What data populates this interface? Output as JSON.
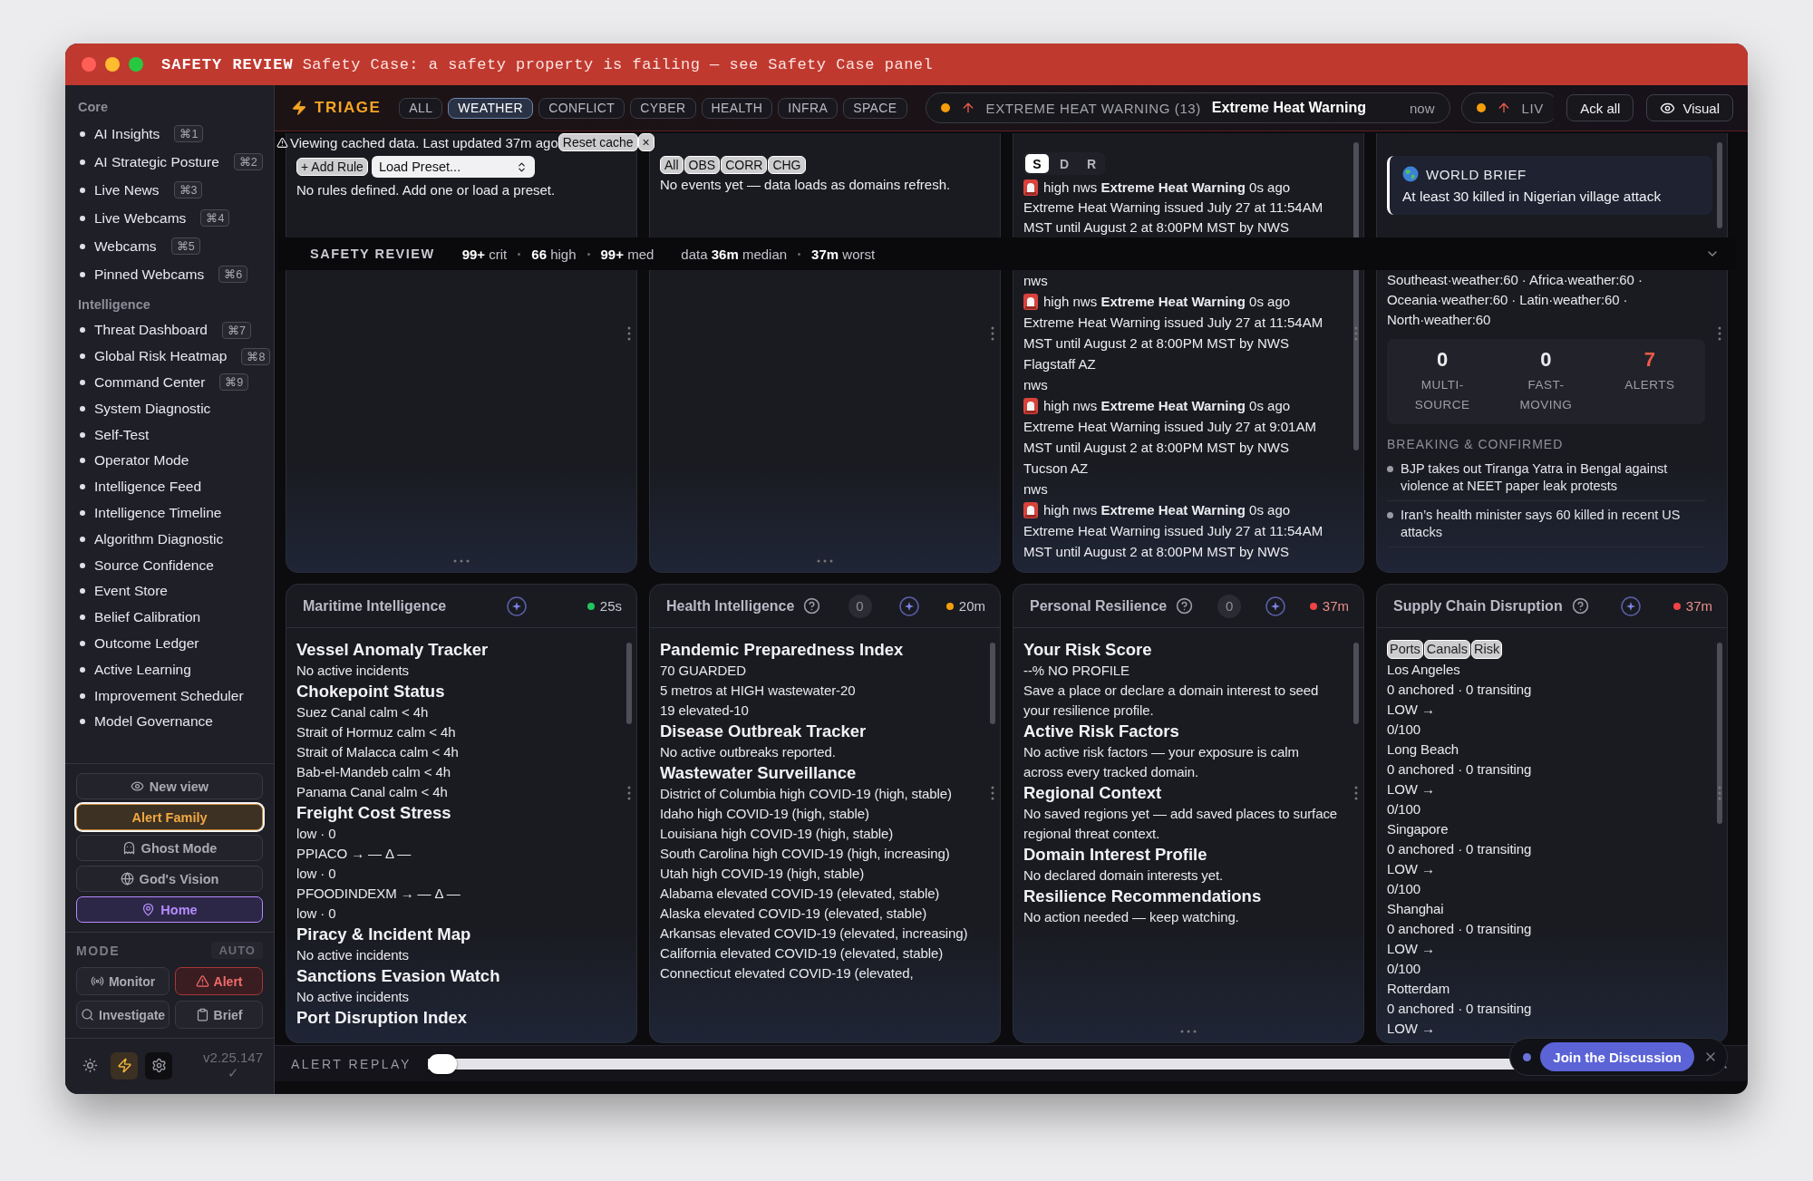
{
  "window": {
    "title": "SAFETY REVIEW",
    "message": "Safety Case: a safety property is failing — see Safety Case panel"
  },
  "sidebar": {
    "sections": [
      {
        "title": "Core",
        "items": [
          {
            "label": "AI Insights",
            "shortcut": "⌘1"
          },
          {
            "label": "AI Strategic Posture",
            "shortcut": "⌘2"
          },
          {
            "label": "Live News",
            "shortcut": "⌘3"
          },
          {
            "label": "Live Webcams",
            "shortcut": "⌘4"
          },
          {
            "label": "Webcams",
            "shortcut": "⌘5"
          },
          {
            "label": "Pinned Webcams",
            "shortcut": "⌘6"
          }
        ]
      },
      {
        "title": "Intelligence",
        "items": [
          {
            "label": "Threat Dashboard",
            "shortcut": "⌘7"
          },
          {
            "label": "Global Risk Heatmap",
            "shortcut": "⌘8"
          },
          {
            "label": "Command Center",
            "shortcut": "⌘9"
          },
          {
            "label": "System Diagnostic"
          },
          {
            "label": "Self-Test"
          },
          {
            "label": "Operator Mode"
          },
          {
            "label": "Intelligence Feed"
          },
          {
            "label": "Intelligence Timeline"
          },
          {
            "label": "Algorithm Diagnostic"
          },
          {
            "label": "Source Confidence"
          },
          {
            "label": "Event Store"
          },
          {
            "label": "Belief Calibration"
          },
          {
            "label": "Outcome Ledger"
          },
          {
            "label": "Active Learning"
          },
          {
            "label": "Improvement Scheduler"
          },
          {
            "label": "Model Governance"
          }
        ]
      }
    ],
    "view_buttons": [
      {
        "label": "New view",
        "selected": false
      },
      {
        "label": "Alert Family",
        "selected": true
      },
      {
        "label": "Ghost Mode",
        "selected": false
      },
      {
        "label": "God's Vision",
        "selected": false
      },
      {
        "label": "Home",
        "selected": false,
        "color": "#b48cff"
      }
    ],
    "mode": {
      "title": "MODE",
      "auto": "AUTO",
      "buttons": [
        {
          "label": "Monitor",
          "selected": false
        },
        {
          "label": "Alert",
          "selected": true
        },
        {
          "label": "Investigate",
          "selected": false
        },
        {
          "label": "Brief",
          "selected": false
        }
      ]
    },
    "footer": {
      "tools": [
        {
          "selected": false
        },
        {
          "selected": true
        },
        {
          "selected": false
        }
      ],
      "version": "v2.25.147",
      "status": "✓"
    }
  },
  "triage": {
    "title": "TRIAGE",
    "filters": [
      {
        "label": "ALL",
        "selected": false
      },
      {
        "label": "WEATHER",
        "selected": true
      },
      {
        "label": "CONFLICT",
        "selected": false
      },
      {
        "label": "CYBER",
        "selected": false
      },
      {
        "label": "HEALTH",
        "selected": false
      },
      {
        "label": "INFRA",
        "selected": false
      },
      {
        "label": "SPACE",
        "selected": false
      }
    ],
    "tickers": [
      {
        "category": "EXTREME HEAT WARNING (13)",
        "headline": "Extreme Heat Warning",
        "time": "now"
      },
      {
        "category": "LIV"
      }
    ],
    "ack": "Ack all",
    "visual": "Visual"
  },
  "cache_notice": {
    "text": "Viewing cached data. Last updated 37m ago",
    "reset": "Reset cache",
    "close": "×"
  },
  "safety_strip": {
    "title": "SAFETY REVIEW",
    "counts": [
      "**99+** crit",
      "**66** high",
      "**99+** med"
    ],
    "freshness": [
      "data **36m** median",
      "**37m** worst"
    ]
  },
  "rules_panel": {
    "add": "+ Add Rule",
    "preset": "Load Preset...",
    "empty": "No rules defined. Add one or load a preset."
  },
  "events_panel": {
    "filters": [
      "All",
      "OBS",
      "CORR",
      "CHG"
    ],
    "empty": "No events yet — data loads as domains refresh."
  },
  "feed_panel": {
    "tabs": [
      {
        "label": "S",
        "selected": true
      },
      {
        "label": "D",
        "selected": false
      },
      {
        "label": "R",
        "selected": false
      }
    ],
    "top_item": {
      "header": "high nws **Extreme Heat Warning** 0s ago",
      "body": "Extreme Heat Warning issued July 27 at 11:54AM MST until August 2 at 8:00PM MST by NWS"
    },
    "continued": "nws",
    "items": [
      {
        "header": "high nws **Extreme Heat Warning** 0s ago",
        "body": "Extreme Heat Warning issued July 27 at 11:54AM MST until August 2 at 8:00PM MST by NWS",
        "location": "Flagstaff AZ",
        "source": "nws"
      },
      {
        "header": "high nws **Extreme Heat Warning** 0s ago",
        "body": "Extreme Heat Warning issued July 27 at 9:01AM MST until August 2 at 8:00PM MST by NWS",
        "location": "Tucson AZ",
        "source": "nws"
      },
      {
        "header": "high nws **Extreme Heat Warning** 0s ago",
        "body": "Extreme Heat Warning issued July 27 at 11:54AM MST until August 2 at 8:00PM MST by NWS"
      }
    ]
  },
  "brief_panel": {
    "brief": {
      "title": "WORLD BRIEF",
      "text": "At least 30 killed in Nigerian village attack"
    },
    "regions": "Southeast·weather:60 · Africa·weather:60 · Oceania·weather:60 · Latin·weather:60 · North·weather:60",
    "stats": [
      {
        "value": "0",
        "label": "MULTI-SOURCE",
        "alert": false
      },
      {
        "value": "0",
        "label": "FAST-MOVING",
        "alert": false
      },
      {
        "value": "7",
        "label": "ALERTS",
        "alert": true
      }
    ],
    "section": "BREAKING & CONFIRMED",
    "headlines": [
      "BJP takes out Tiranga Yatra in Bengal against violence at NEET paper leak protests",
      "Iran’s health minister says 60 killed in recent US attacks"
    ]
  },
  "panels": [
    {
      "kind": "sections",
      "title": "Maritime Intelligence",
      "help": false,
      "updated": "25s",
      "color": "#22c55e",
      "stale": false,
      "sections": [
        {
          "heading": "Vessel Anomaly Tracker",
          "lines": [
            "No active incidents"
          ]
        },
        {
          "heading": "Chokepoint Status",
          "lines": [
            "Suez Canal calm < 4h",
            "Strait of Hormuz calm < 4h",
            "Strait of Malacca calm < 4h",
            "Bab-el-Mandeb calm < 4h",
            "Panama Canal calm < 4h"
          ]
        },
        {
          "heading": "Freight Cost Stress",
          "lines": [
            "low · 0",
            "PPIACO → — Δ —",
            "low · 0",
            "PFOODINDEXM → — Δ —",
            "low · 0"
          ]
        },
        {
          "heading": "Piracy & Incident Map",
          "lines": [
            "No active incidents"
          ]
        },
        {
          "heading": "Sanctions Evasion Watch",
          "lines": [
            "No active incidents"
          ]
        },
        {
          "heading": "Port Disruption Index"
        }
      ]
    },
    {
      "kind": "sections",
      "title": "Health Intelligence",
      "help": true,
      "count": "0",
      "updated": "20m",
      "color": "#f59e0b",
      "stale": false,
      "sections": [
        {
          "heading": "Pandemic Preparedness Index",
          "lines": [
            "70 GUARDED",
            "5 metros at HIGH wastewater-20",
            "19 elevated-10"
          ]
        },
        {
          "heading": "Disease Outbreak Tracker",
          "lines": [
            "No active outbreaks reported."
          ]
        },
        {
          "heading": "Wastewater Surveillance",
          "lines": [
            "District of Columbia high COVID-19 (high, stable)",
            "Idaho high COVID-19 (high, stable)",
            "Louisiana high COVID-19 (high, stable)",
            "South Carolina high COVID-19 (high, increasing)",
            "Utah high COVID-19 (high, stable)",
            "Alabama elevated COVID-19 (elevated, stable)",
            "Alaska elevated COVID-19 (elevated, stable)",
            "Arkansas elevated COVID-19 (elevated, increasing)",
            "California elevated COVID-19 (elevated, stable)",
            "Connecticut elevated COVID-19 (elevated,"
          ]
        }
      ]
    },
    {
      "kind": "sections",
      "title": "Personal Resilience",
      "help": true,
      "count": "0",
      "updated": "37m",
      "color": "#ef4444",
      "stale": true,
      "sections": [
        {
          "heading": "Your Risk Score",
          "lines": [
            "--% NO PROFILE",
            "Save a place or declare a domain interest to seed your resilience profile."
          ]
        },
        {
          "heading": "Active Risk Factors",
          "lines": [
            "No active risk factors — your exposure is calm across every tracked domain."
          ]
        },
        {
          "heading": "Regional Context",
          "lines": [
            "No saved regions yet — add saved places to surface regional threat context."
          ]
        },
        {
          "heading": "Domain Interest Profile",
          "lines": [
            "No declared domain interests yet."
          ]
        },
        {
          "heading": "Resilience Recommendations",
          "lines": [
            "No action needed — keep watching."
          ]
        }
      ]
    },
    {
      "kind": "ports",
      "title": "Supply Chain Disruption",
      "help": true,
      "updated": "37m",
      "color": "#ef4444",
      "stale": true,
      "chips": [
        "Ports",
        "Canals",
        "Risk"
      ],
      "ports": [
        {
          "name": "Los Angeles",
          "traffic": "0 anchored · 0 transiting",
          "risk": "LOW →",
          "score": "0/100"
        },
        {
          "name": "Long Beach",
          "traffic": "0 anchored · 0 transiting",
          "risk": "LOW →",
          "score": "0/100"
        },
        {
          "name": "Singapore",
          "traffic": "0 anchored · 0 transiting",
          "risk": "LOW →",
          "score": "0/100"
        },
        {
          "name": "Shanghai",
          "traffic": "0 anchored · 0 transiting",
          "risk": "LOW →",
          "score": "0/100"
        },
        {
          "name": "Rotterdam",
          "traffic": "0 anchored · 0 transiting",
          "risk": "LOW →"
        }
      ]
    }
  ],
  "replay": {
    "label": "ALERT REPLAY",
    "level": 0
  },
  "join": {
    "label": "Join the Discussion"
  }
}
